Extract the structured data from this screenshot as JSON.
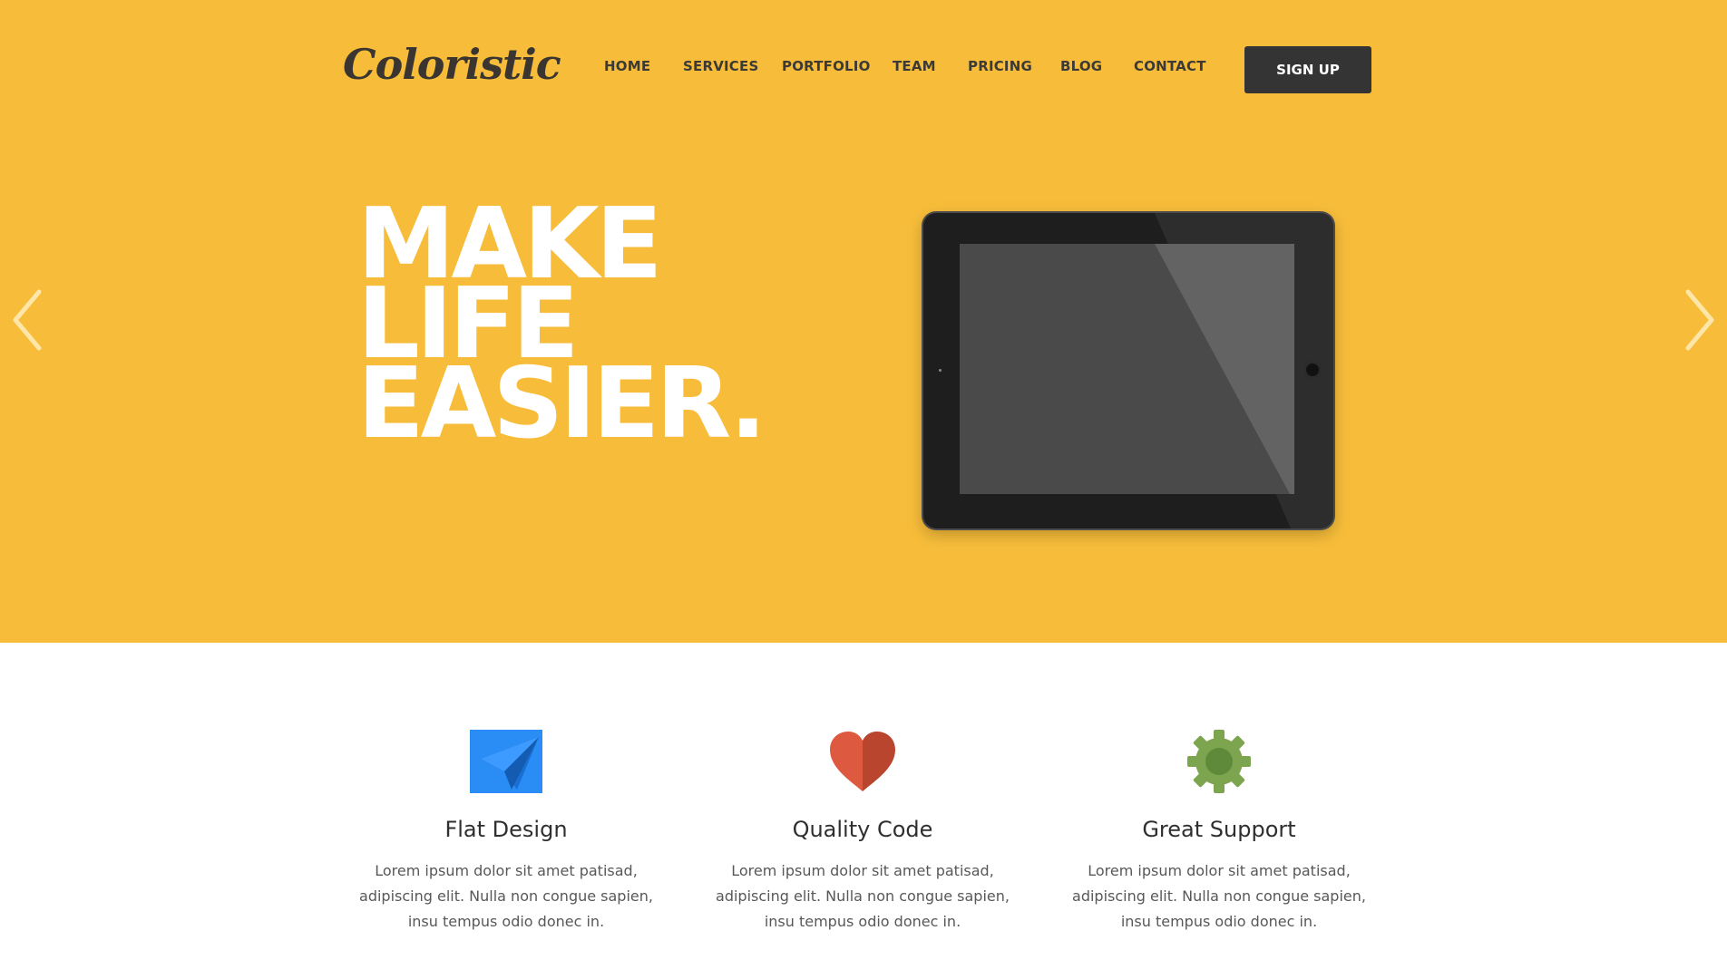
{
  "brand": {
    "logo_text": "Coloristic"
  },
  "nav": {
    "items": [
      {
        "label": "HOME"
      },
      {
        "label": "SERVICES"
      },
      {
        "label": "PORTFOLIO"
      },
      {
        "label": "TEAM"
      },
      {
        "label": "PRICING"
      },
      {
        "label": "BLOG"
      },
      {
        "label": "CONTACT"
      }
    ],
    "signup_label": "SIGN UP"
  },
  "hero": {
    "headline_lines": [
      "MAKE",
      "LIFE",
      "EASIER."
    ],
    "background_color": "#f7bd3a",
    "prev_icon": "chevron-left-icon",
    "next_icon": "chevron-right-icon"
  },
  "features": [
    {
      "icon": "paper-plane-icon",
      "icon_color": "#2a8cf5",
      "title": "Flat Design",
      "text": "Lorem ipsum dolor sit amet patisad, adipiscing elit. Nulla non congue sapien, insu tempus odio donec in."
    },
    {
      "icon": "heart-icon",
      "icon_color": "#d8543d",
      "title": "Quality Code",
      "text": "Lorem ipsum dolor sit amet patisad, adipiscing elit. Nulla non congue sapien, insu tempus odio donec in."
    },
    {
      "icon": "gear-icon",
      "icon_color": "#7da550",
      "title": "Great Support",
      "text": "Lorem ipsum dolor sit amet patisad, adipiscing elit. Nulla non congue sapien, insu tempus odio donec in."
    }
  ]
}
